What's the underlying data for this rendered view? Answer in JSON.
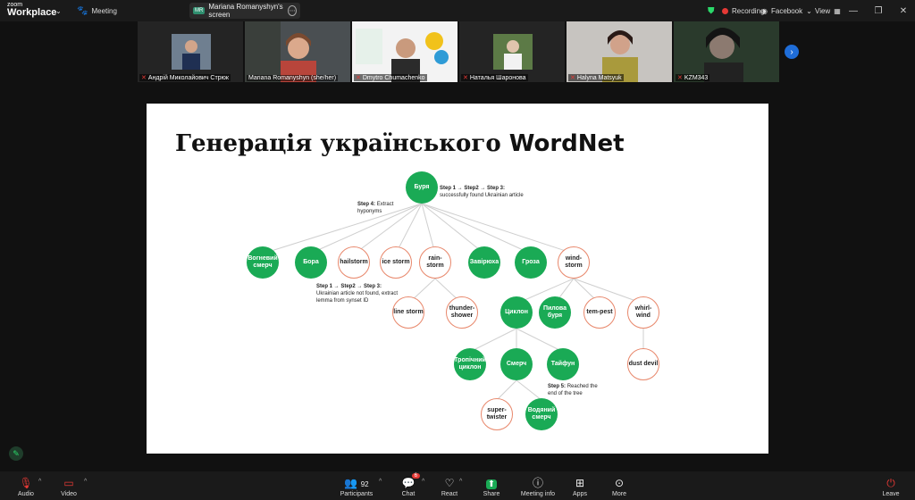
{
  "app": {
    "logo_line1": "zoom",
    "logo_line2": "Workplace",
    "meeting_label": "Meeting",
    "screen_share_label": "Mariana Romanyshyn's screen",
    "screen_share_badge": "MR"
  },
  "topbar": {
    "recording_label": "Recording",
    "facebook_label": "Facebook",
    "view_label": "View"
  },
  "participants": [
    {
      "name": "Андрій Миколайович Стрюк"
    },
    {
      "name": "Mariana Romanyshyn (she/her)"
    },
    {
      "name": "Dmytro Chumachenko"
    },
    {
      "name": "Наталья Шаронова"
    },
    {
      "name": "Halyna Matsyuk"
    },
    {
      "name": "KZM343"
    }
  ],
  "slide": {
    "title_ua": "Генерація українського",
    "title_en": "WordNet",
    "nodes": {
      "root": "Буря",
      "vortex": "Вогневий смерч",
      "bora": "Бора",
      "hailstorm": "hailstorm",
      "ice": "ice storm",
      "rain": "rain-storm",
      "zaviryuha": "Завірюха",
      "groza": "Гроза",
      "wind": "wind-storm",
      "line": "line storm",
      "thunder": "thunder-shower",
      "cyclone": "Циклон",
      "dust_storm": "Пилова буря",
      "tempest": "tem-pest",
      "whirlwind": "whirl-wind",
      "tropical": "Тропічний циклон",
      "smerch": "Смерч",
      "typhoon": "Тайфун",
      "dust_devil": "dust devil",
      "supertwister": "super-twister",
      "water_spout": "Водяний смерч"
    },
    "notes": {
      "step123_head": "Step 1 → Step2 → Step 3:",
      "step123_body": "successfully found Ukrainian article",
      "step4_head": "Step 4:",
      "step4_body": "Extract hyponyms",
      "step123b_head": "Step 1 → Step2 → Step 3:",
      "step123b_body": "Ukrainian article not found, extract lemma from synset ID",
      "step5_head": "Step 5:",
      "step5_body": "Reached the end of the tree"
    }
  },
  "bottombar": {
    "audio": "Audio",
    "video": "Video",
    "participants": "Participants",
    "participants_count": "92",
    "chat": "Chat",
    "chat_badge": "6",
    "react": "React",
    "share": "Share",
    "meeting_info": "Meeting info",
    "apps": "Apps",
    "more": "More",
    "leave": "Leave"
  },
  "colors": {
    "accent_green": "#1aaa55",
    "node_outline": "#e8876b",
    "leave_red": "#e53935",
    "active_speaker": "#2bd96a"
  }
}
